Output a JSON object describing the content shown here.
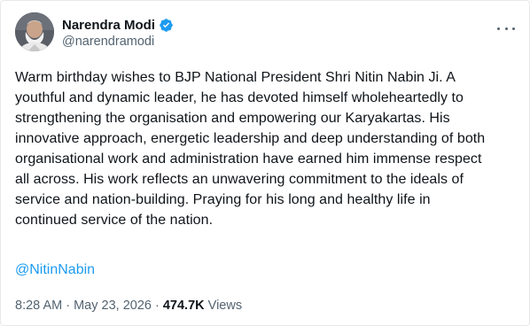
{
  "tweet": {
    "author": {
      "display_name": "Narendra Modi",
      "handle": "@narendramodi",
      "verified": true
    },
    "text": "Warm birthday wishes to BJP National President Shri Nitin Nabin Ji. A\nyouthful and dynamic leader, he has devoted himself wholeheartedly to\nstrengthening the organisation and empowering our Karyakartas. His\ninnovative approach, energetic leadership and deep understanding of both\norganisational work and administration have earned him immense respect\nall across. His work reflects an unwavering commitment to the ideals of\nservice and nation-building. Praying for his long and healthy life in\ncontinued service of the nation.",
    "mention": "@NitinNabin",
    "time": "8:28 AM",
    "separator": " · ",
    "date": "May 23, 2026",
    "views_count": "474.7K",
    "views_label": "Views"
  },
  "colors": {
    "text": "#0f1419",
    "secondary": "#536471",
    "link": "#1d9bf0",
    "verified": "#1d9bf0"
  },
  "icons": {
    "verified": "verified-badge-icon",
    "more": "more-dots-icon"
  }
}
